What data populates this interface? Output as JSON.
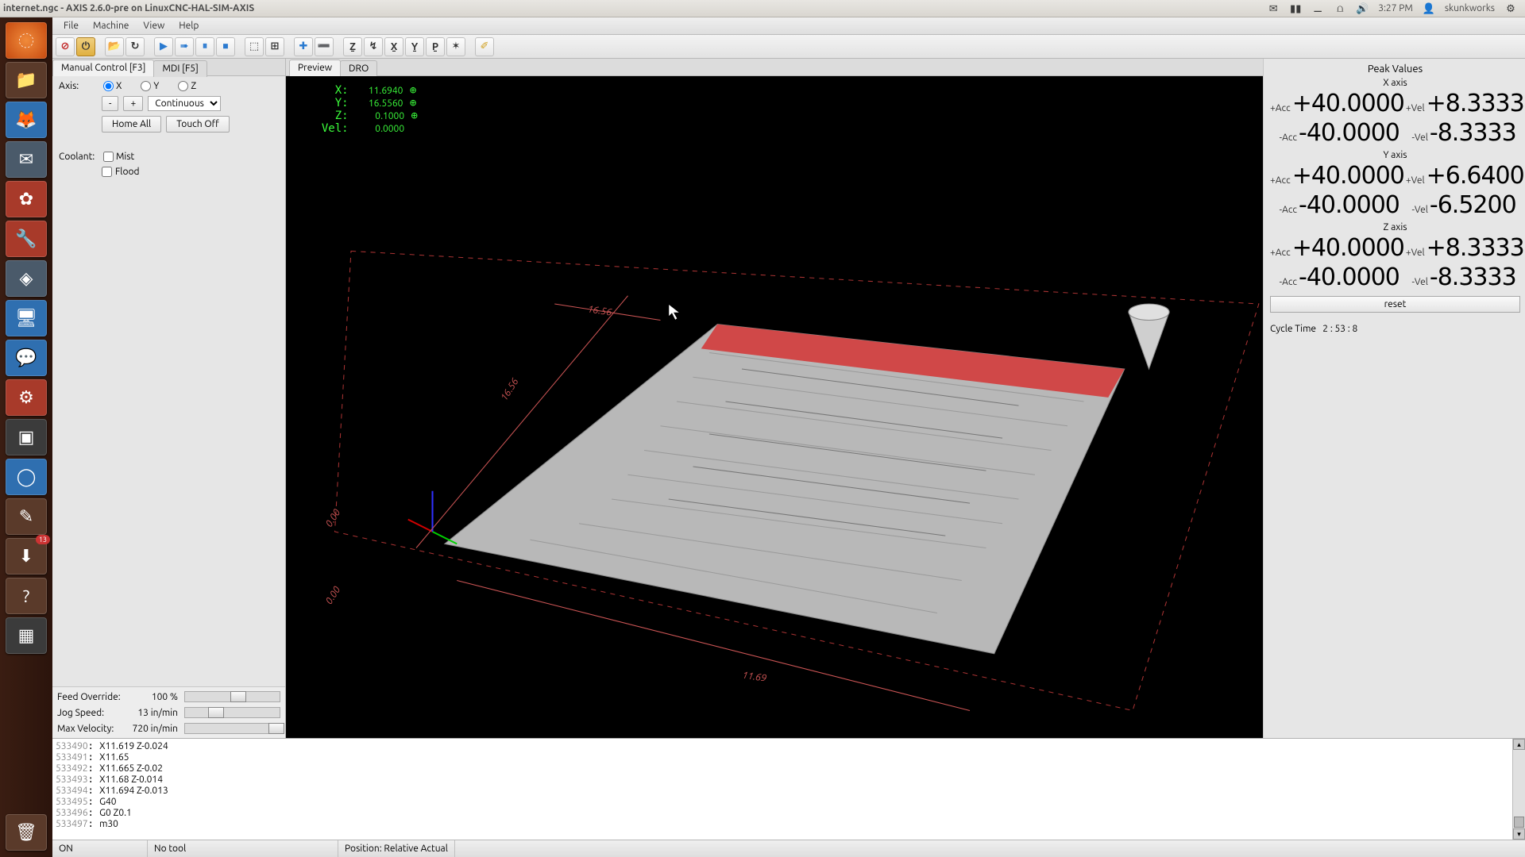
{
  "os": {
    "title": "internet.ngc - AXIS 2.6.0-pre on LinuxCNC-HAL-SIM-AXIS",
    "clock": "3:27 PM",
    "user": "skunkworks",
    "badge": "13"
  },
  "menubar": [
    "File",
    "Machine",
    "View",
    "Help"
  ],
  "toolbar_icons": [
    "estop",
    "power",
    "open",
    "reload",
    "play",
    "step",
    "pause",
    "stop",
    "zoom-limits",
    "zoom-path",
    "home",
    "touch",
    "clear-z",
    "clear-g",
    "clear-x",
    "clear-y",
    "clear-p",
    "tool",
    "brush"
  ],
  "left": {
    "tabs": {
      "manual": "Manual Control [F3]",
      "mdi": "MDI [F5]"
    },
    "axis_label": "Axis:",
    "axes": [
      "X",
      "Y",
      "Z"
    ],
    "jogminus": "-",
    "jogplus": "+",
    "jogmode": "Continuous",
    "home": "Home All",
    "touch": "Touch Off",
    "coolant_label": "Coolant:",
    "mist": "Mist",
    "flood": "Flood",
    "sliders": [
      {
        "label": "Feed Override:",
        "value": "100 %",
        "pos": 60
      },
      {
        "label": "Jog Speed:",
        "value": "13 in/min",
        "pos": 22
      },
      {
        "label": "Max Velocity:",
        "value": "720 in/min",
        "pos": 92
      }
    ]
  },
  "center": {
    "tabs": {
      "preview": "Preview",
      "dro": "DRO"
    },
    "dro": {
      "X": "11.6940",
      "Y": "16.5560",
      "Z": "0.1000",
      "Vel": "0.0000"
    },
    "dims": {
      "width": "11.69",
      "height": "16.56",
      "z": "0.00"
    }
  },
  "right": {
    "title": "Peak Values",
    "axes": [
      {
        "name": "X axis",
        "pacc": "+40.0000",
        "pvel": "+8.3333",
        "nacc": "-40.0000",
        "nvel": "-8.3333"
      },
      {
        "name": "Y axis",
        "pacc": "+40.0000",
        "pvel": "+6.6400",
        "nacc": "-40.0000",
        "nvel": "-6.5200"
      },
      {
        "name": "Z axis",
        "pacc": "+40.0000",
        "pvel": "+8.3333",
        "nacc": "-40.0000",
        "nvel": "-8.3333"
      }
    ],
    "reset": "reset",
    "cycle_label": "Cycle Time",
    "cycle_value": "2 : 53 :  8"
  },
  "gcode": [
    {
      "n": "533490",
      "t": "X11.619 Z-0.024"
    },
    {
      "n": "533491",
      "t": "X11.65"
    },
    {
      "n": "533492",
      "t": "X11.665 Z-0.02"
    },
    {
      "n": "533493",
      "t": "X11.68 Z-0.014"
    },
    {
      "n": "533494",
      "t": "X11.694 Z-0.013"
    },
    {
      "n": "533495",
      "t": "G40"
    },
    {
      "n": "533496",
      "t": "G0 Z0.1"
    },
    {
      "n": "533497",
      "t": "m30"
    }
  ],
  "status": {
    "c1": "ON",
    "c2": "No tool",
    "c3": "Position: Relative Actual"
  }
}
